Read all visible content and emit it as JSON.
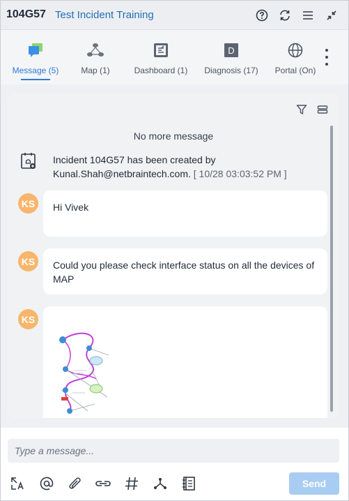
{
  "header": {
    "incident_id": "104G57",
    "incident_name": "Test Incident Training",
    "icons": [
      "help-icon",
      "refresh-icon",
      "menu-icon",
      "collapse-icon"
    ]
  },
  "tabs": [
    {
      "label": "Message (5)",
      "icon": "message-icon",
      "active": true
    },
    {
      "label": "Map (1)",
      "icon": "map-icon",
      "active": false
    },
    {
      "label": "Dashboard (1)",
      "icon": "dashboard-icon",
      "active": false
    },
    {
      "label": "Diagnosis (17)",
      "icon": "diagnosis-icon",
      "active": false
    },
    {
      "label": "Portal (On)",
      "icon": "globe-icon",
      "active": false
    }
  ],
  "panel": {
    "no_more": "No more message",
    "system_message": {
      "text": "Incident 104G57 has been created by Kunal.Shah@netbraintech.com.",
      "time": "[ 10/28 03:03:52 PM ]"
    },
    "messages": [
      {
        "avatar": "KS",
        "text": "Hi Vivek"
      },
      {
        "avatar": "KS",
        "text": "Could you please check interface status on all the devices of MAP"
      },
      {
        "avatar": "KS",
        "text": "",
        "attachment": "map-thumbnail"
      }
    ]
  },
  "composer": {
    "placeholder": "Type a message...",
    "send_label": "Send",
    "tools": [
      "translate-icon",
      "mention-icon",
      "attach-icon",
      "link-icon",
      "hashtag-icon",
      "path-icon",
      "notebook-icon"
    ]
  },
  "colors": {
    "accent": "#2d7bd3",
    "avatar": "#f7b66c",
    "send_disabled": "#a9cdf2"
  }
}
